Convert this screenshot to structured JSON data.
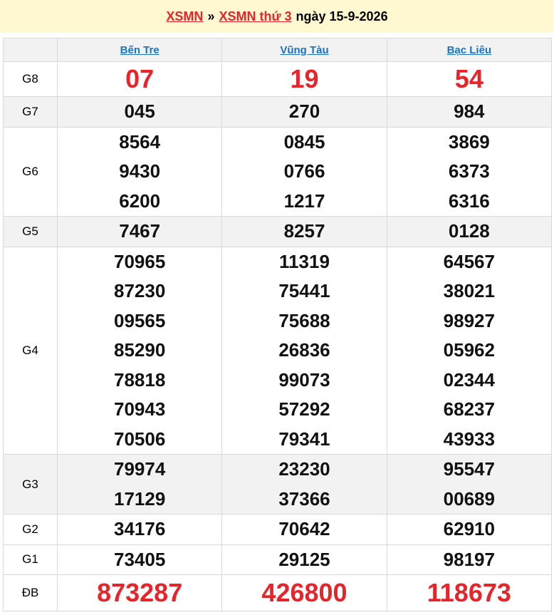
{
  "header": {
    "link1": "XSMN",
    "sep": "»",
    "link2": "XSMN thứ 3",
    "date": "ngày 15-9-2026"
  },
  "provinces": [
    "Bến Tre",
    "Vũng Tàu",
    "Bạc Liêu"
  ],
  "prizes": [
    {
      "label": "G8",
      "values": [
        [
          "07"
        ],
        [
          "19"
        ],
        [
          "54"
        ]
      ]
    },
    {
      "label": "G7",
      "values": [
        [
          "045"
        ],
        [
          "270"
        ],
        [
          "984"
        ]
      ]
    },
    {
      "label": "G6",
      "values": [
        [
          "8564",
          "9430",
          "6200"
        ],
        [
          "0845",
          "0766",
          "1217"
        ],
        [
          "3869",
          "6373",
          "6316"
        ]
      ]
    },
    {
      "label": "G5",
      "values": [
        [
          "7467"
        ],
        [
          "8257"
        ],
        [
          "0128"
        ]
      ]
    },
    {
      "label": "G4",
      "values": [
        [
          "70965",
          "87230",
          "09565",
          "85290",
          "78818",
          "70943",
          "70506"
        ],
        [
          "11319",
          "75441",
          "75688",
          "26836",
          "99073",
          "57292",
          "79341"
        ],
        [
          "64567",
          "38021",
          "98927",
          "05962",
          "02344",
          "68237",
          "43933"
        ]
      ]
    },
    {
      "label": "G3",
      "values": [
        [
          "79974",
          "17129"
        ],
        [
          "23230",
          "37366"
        ],
        [
          "95547",
          "00689"
        ]
      ]
    },
    {
      "label": "G2",
      "values": [
        [
          "34176"
        ],
        [
          "70642"
        ],
        [
          "62910"
        ]
      ]
    },
    {
      "label": "G1",
      "values": [
        [
          "73405"
        ],
        [
          "29125"
        ],
        [
          "98197"
        ]
      ]
    },
    {
      "label": "ĐB",
      "values": [
        [
          "873287"
        ],
        [
          "426800"
        ],
        [
          "118673"
        ]
      ]
    }
  ]
}
